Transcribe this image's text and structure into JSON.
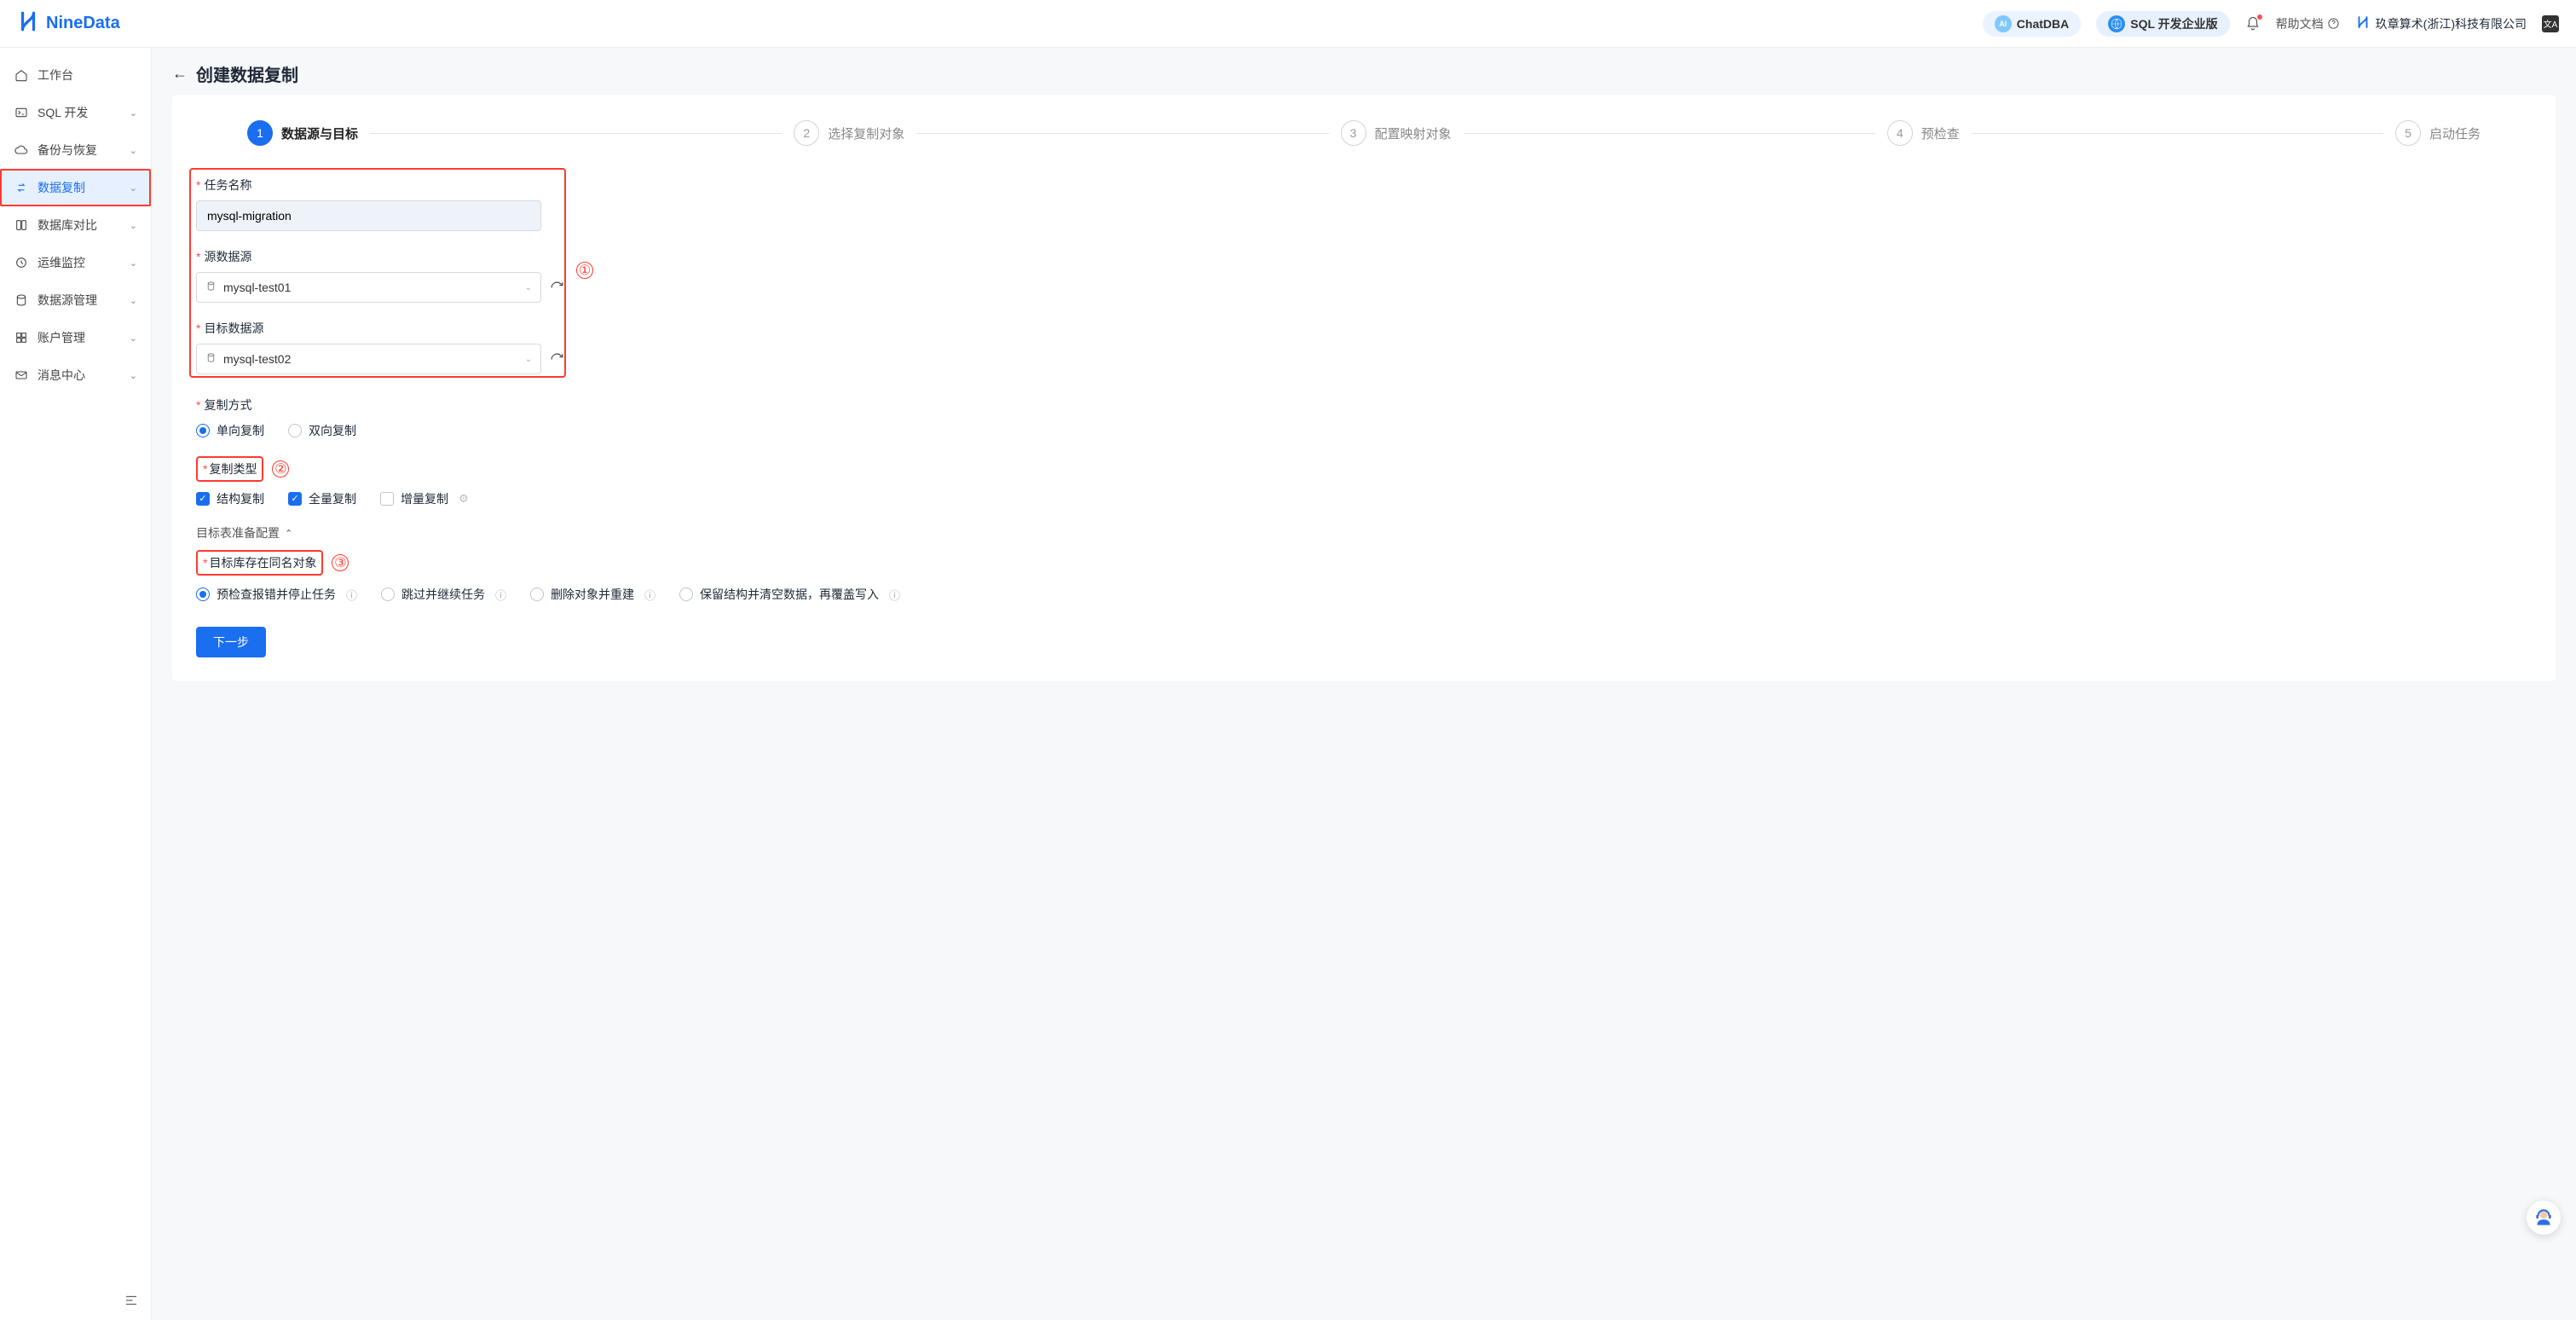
{
  "brand": "NineData",
  "header": {
    "chatdba": "ChatDBA",
    "sql_enterprise": "SQL 开发企业版",
    "help_doc": "帮助文档",
    "company": "玖章算术(浙江)科技有限公司"
  },
  "sidebar": {
    "items": [
      {
        "label": "工作台",
        "expandable": false
      },
      {
        "label": "SQL 开发",
        "expandable": true
      },
      {
        "label": "备份与恢复",
        "expandable": true
      },
      {
        "label": "数据复制",
        "expandable": true,
        "active": true
      },
      {
        "label": "数据库对比",
        "expandable": true
      },
      {
        "label": "运维监控",
        "expandable": true
      },
      {
        "label": "数据源管理",
        "expandable": true
      },
      {
        "label": "账户管理",
        "expandable": true
      },
      {
        "label": "消息中心",
        "expandable": true
      }
    ]
  },
  "page": {
    "title": "创建数据复制"
  },
  "steps": [
    {
      "num": "1",
      "label": "数据源与目标"
    },
    {
      "num": "2",
      "label": "选择复制对象"
    },
    {
      "num": "3",
      "label": "配置映射对象"
    },
    {
      "num": "4",
      "label": "预检查"
    },
    {
      "num": "5",
      "label": "启动任务"
    }
  ],
  "form": {
    "task_name_label": "任务名称",
    "task_name_value": "mysql-migration",
    "source_label": "源数据源",
    "source_value": "mysql-test01",
    "target_label": "目标数据源",
    "target_value": "mysql-test02",
    "copy_mode_label": "复制方式",
    "copy_mode_options": {
      "one_way": "单向复制",
      "two_way": "双向复制"
    },
    "copy_type_label": "复制类型",
    "copy_type_options": {
      "struct": "结构复制",
      "full": "全量复制",
      "incr": "增量复制"
    },
    "target_prep_header": "目标表准备配置",
    "same_name_label": "目标库存在同名对象",
    "same_name_options": {
      "precheck_stop": "预检查报错并停止任务",
      "skip": "跳过并继续任务",
      "drop_rebuild": "删除对象并重建",
      "keep_clear": "保留结构并清空数据，再覆盖写入"
    },
    "next": "下一步"
  },
  "annotations": {
    "a1": "①",
    "a2": "②",
    "a3": "③"
  }
}
